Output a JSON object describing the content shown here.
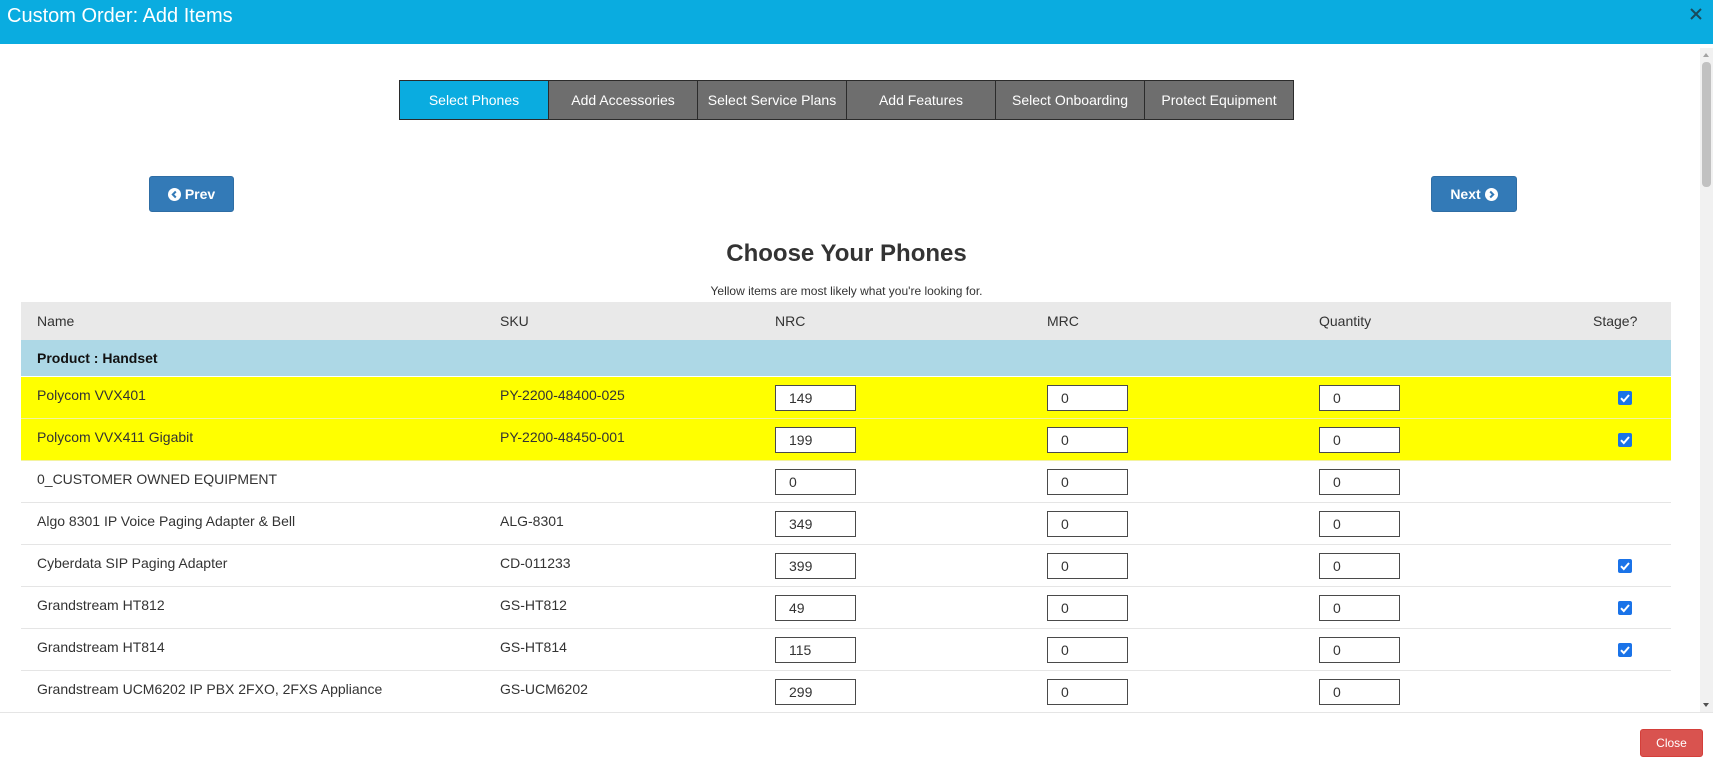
{
  "window": {
    "title": "Custom Order: Add Items"
  },
  "steps": [
    {
      "label": "Select Phones",
      "active": true
    },
    {
      "label": "Add Accessories",
      "active": false
    },
    {
      "label": "Select Service Plans",
      "active": false
    },
    {
      "label": "Add Features",
      "active": false
    },
    {
      "label": "Select Onboarding",
      "active": false
    },
    {
      "label": "Protect Equipment",
      "active": false
    }
  ],
  "nav": {
    "prev_label": "Prev",
    "next_label": "Next"
  },
  "main": {
    "heading": "Choose Your Phones",
    "subtext": "Yellow items are most likely what you're looking for."
  },
  "table": {
    "columns": {
      "name": "Name",
      "sku": "SKU",
      "nrc": "NRC",
      "mrc": "MRC",
      "quantity": "Quantity",
      "stage": "Stage?"
    },
    "group_label": "Product : Handset",
    "rows": [
      {
        "name": "Polycom VVX401",
        "sku": "PY-2200-48400-025",
        "nrc": "149",
        "mrc": "0",
        "quantity": "0",
        "stage": true,
        "highlight": true
      },
      {
        "name": "Polycom VVX411 Gigabit",
        "sku": "PY-2200-48450-001",
        "nrc": "199",
        "mrc": "0",
        "quantity": "0",
        "stage": true,
        "highlight": true
      },
      {
        "name": "0_CUSTOMER OWNED EQUIPMENT",
        "sku": "",
        "nrc": "0",
        "mrc": "0",
        "quantity": "0",
        "stage": false,
        "highlight": false
      },
      {
        "name": "Algo 8301 IP Voice Paging Adapter & Bell",
        "sku": "ALG-8301",
        "nrc": "349",
        "mrc": "0",
        "quantity": "0",
        "stage": false,
        "highlight": false
      },
      {
        "name": "Cyberdata SIP Paging Adapter",
        "sku": "CD-011233",
        "nrc": "399",
        "mrc": "0",
        "quantity": "0",
        "stage": true,
        "highlight": false
      },
      {
        "name": "Grandstream HT812",
        "sku": "GS-HT812",
        "nrc": "49",
        "mrc": "0",
        "quantity": "0",
        "stage": true,
        "highlight": false
      },
      {
        "name": "Grandstream HT814",
        "sku": "GS-HT814",
        "nrc": "115",
        "mrc": "0",
        "quantity": "0",
        "stage": true,
        "highlight": false
      },
      {
        "name": "Grandstream UCM6202 IP PBX 2FXO, 2FXS Appliance",
        "sku": "GS-UCM6202",
        "nrc": "299",
        "mrc": "0",
        "quantity": "0",
        "stage": false,
        "highlight": false
      }
    ]
  },
  "footer": {
    "close_label": "Close"
  },
  "colors": {
    "accent": "#0aace0",
    "nav_button": "#337ab7",
    "close_button": "#d9534f",
    "group_row": "#add8e6",
    "highlight_row": "#ffff00",
    "checkbox": "#1a73e8"
  },
  "icons": {
    "window_close": "close-icon",
    "prev": "chevron-circle-left-icon",
    "next": "chevron-circle-right-icon",
    "stage": "checkbox-checked-icon"
  }
}
